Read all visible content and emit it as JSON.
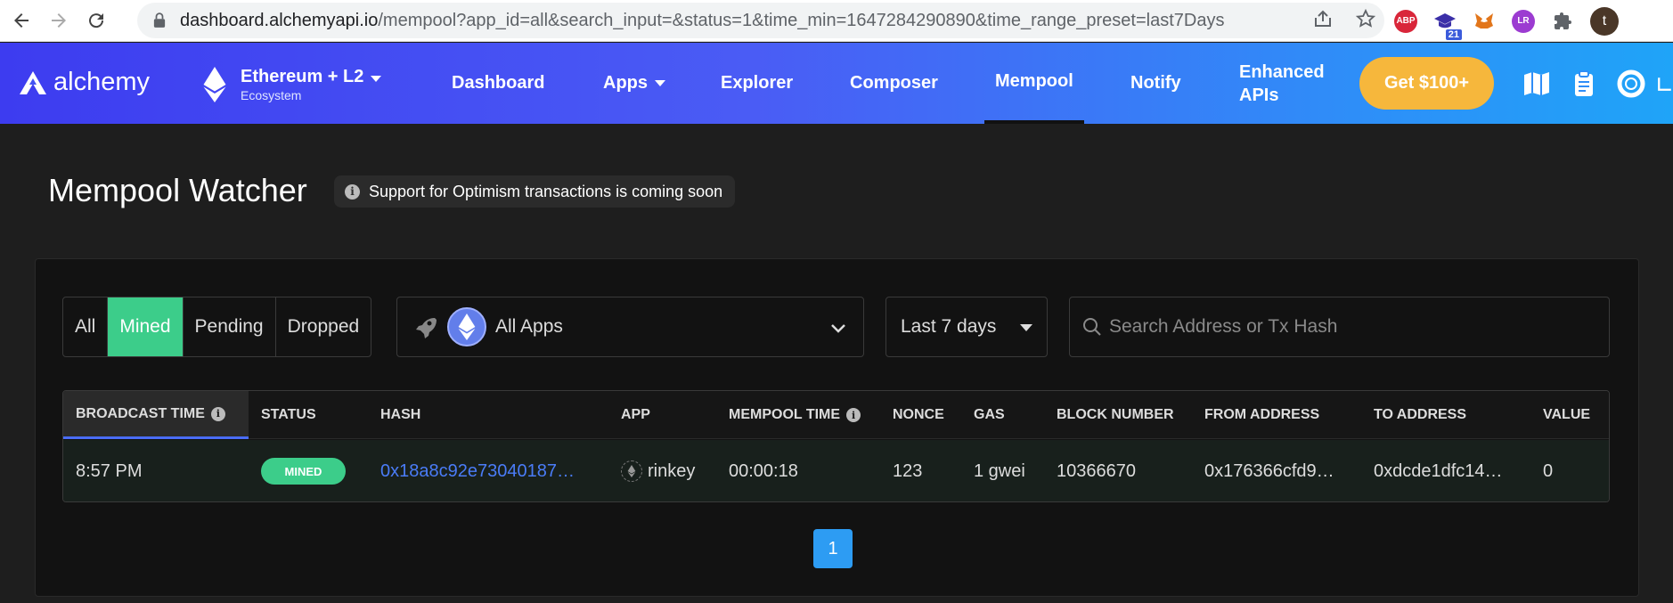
{
  "browser": {
    "url_host": "dashboard.alchemyapi.io",
    "url_rest": "/mempool?app_id=all&search_input=&status=1&time_min=1647284290890&time_range_preset=last7Days",
    "extensions": [
      {
        "name": "abp-extension-icon",
        "label": "ABP",
        "color": "#d9263a"
      },
      {
        "name": "graduation-extension-icon",
        "label": "",
        "badge": "21",
        "color": "#3b2fa8"
      },
      {
        "name": "metamask-extension-icon",
        "label": "",
        "color": "#e2761b"
      },
      {
        "name": "lr-extension-icon",
        "label": "LR",
        "color": "#9c3bd1"
      }
    ],
    "profile_initial": "t"
  },
  "header": {
    "logo_text": "alchemy",
    "network_name": "Ethereum + L2",
    "network_sub": "Ecosystem",
    "nav": {
      "dashboard": "Dashboard",
      "apps": "Apps",
      "explorer": "Explorer",
      "composer": "Composer",
      "mempool": "Mempool",
      "notify": "Notify"
    },
    "enhanced_line1": "Enhanced",
    "enhanced_line2": "APIs",
    "cta": "Get $100+"
  },
  "page": {
    "title": "Mempool Watcher",
    "notice": "Support for Optimism transactions is coming soon"
  },
  "filters": {
    "status_tabs": [
      "All",
      "Mined",
      "Pending",
      "Dropped"
    ],
    "active_status": "Mined",
    "app_select": "All Apps",
    "time_range": "Last 7 days",
    "search_placeholder": "Search Address or Tx Hash"
  },
  "table": {
    "columns": {
      "broadcast_time": "BROADCAST TIME",
      "status": "STATUS",
      "hash": "HASH",
      "app": "APP",
      "mempool_time": "MEMPOOL TIME",
      "nonce": "NONCE",
      "gas": "GAS",
      "block_number": "BLOCK NUMBER",
      "from_address": "FROM ADDRESS",
      "to_address": "TO ADDRESS",
      "value": "VALUE"
    },
    "rows": [
      {
        "broadcast_time": "8:57 PM",
        "status": "MINED",
        "hash": "0x18a8c92e73040187…",
        "app": "rinkey",
        "mempool_time": "00:00:18",
        "nonce": "123",
        "gas": "1 gwei",
        "block_number": "10366670",
        "from_address": "0x176366cfd9…",
        "to_address": "0xdcde1dfc14…",
        "value": "0"
      }
    ]
  },
  "pagination": {
    "current_page": "1"
  },
  "colors": {
    "accent_green": "#3ccd8a",
    "link_blue": "#4a7cf7",
    "cta_yellow": "#f6b73c"
  }
}
